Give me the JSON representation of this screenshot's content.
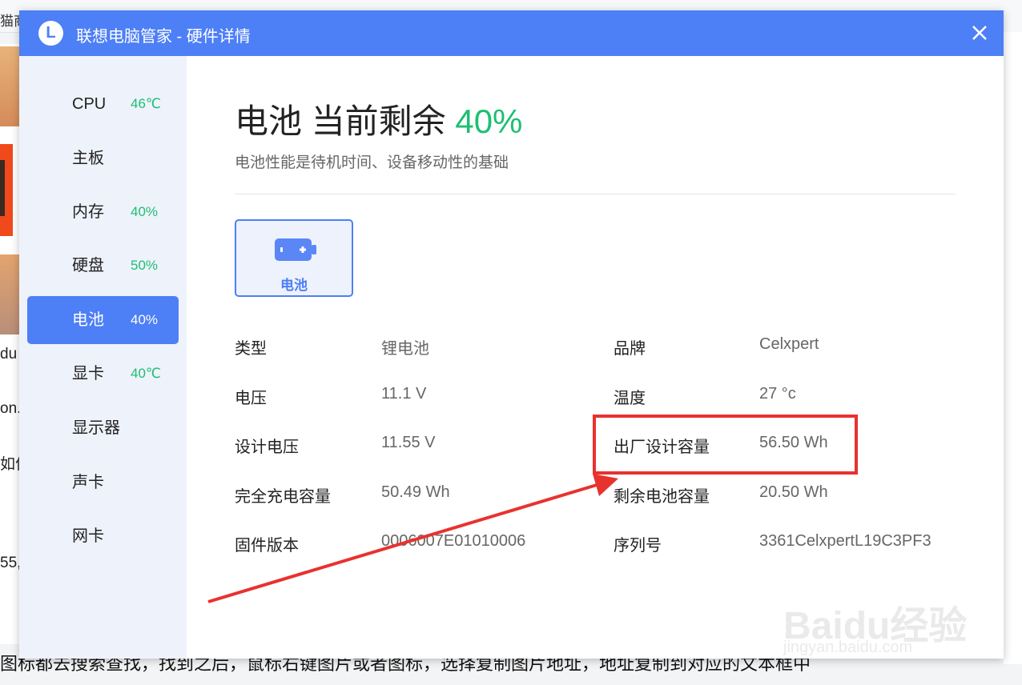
{
  "background": {
    "top_text": "猫商",
    "fragments": [
      "du",
      "on.r",
      "如何",
      "55,"
    ],
    "bottom_text": "图标都去搜索查找，找到之后，鼠标右键图片或者图标，选择复制图片地址，地址复制到对应的文本框中"
  },
  "window": {
    "logo_letter": "L",
    "title": "联想电脑管家 - 硬件详情",
    "close_icon": "close-icon"
  },
  "sidebar": {
    "items": [
      {
        "label": "CPU",
        "value": "46℃",
        "active": false
      },
      {
        "label": "主板",
        "value": "",
        "active": false
      },
      {
        "label": "内存",
        "value": "40%",
        "active": false
      },
      {
        "label": "硬盘",
        "value": "50%",
        "active": false
      },
      {
        "label": "电池",
        "value": "40%",
        "active": true
      },
      {
        "label": "显卡",
        "value": "40℃",
        "active": false
      },
      {
        "label": "显示器",
        "value": "",
        "active": false
      },
      {
        "label": "声卡",
        "value": "",
        "active": false
      },
      {
        "label": "网卡",
        "value": "",
        "active": false
      }
    ]
  },
  "main": {
    "heading_prefix": "电池 当前剩余",
    "heading_percent": "40%",
    "subtitle": "电池性能是待机时间、设备移动性的基础",
    "battery_tab_label": "电池",
    "battery_icon": "battery-icon",
    "fields_left": [
      {
        "label": "类型",
        "value": "锂电池"
      },
      {
        "label": "电压",
        "value": "11.1 V"
      },
      {
        "label": "设计电压",
        "value": "11.55 V"
      },
      {
        "label": "完全充电容量",
        "value": "50.49 Wh"
      },
      {
        "label": "固件版本",
        "value": "0006007E01010006"
      }
    ],
    "fields_right": [
      {
        "label": "品牌",
        "value": "Celxpert"
      },
      {
        "label": "温度",
        "value": "27 °c"
      },
      {
        "label": "出厂设计容量",
        "value": "56.50 Wh"
      },
      {
        "label": "剩余电池容量",
        "value": "20.50 Wh"
      },
      {
        "label": "序列号",
        "value": "3361CelxpertL19C3PF3"
      }
    ]
  },
  "watermark": {
    "text": "Baidu经验",
    "url": "jingyan.baidu.com"
  },
  "colors": {
    "accent": "#4d7ff6",
    "green": "#1dbf73",
    "highlight": "#e8322e"
  }
}
